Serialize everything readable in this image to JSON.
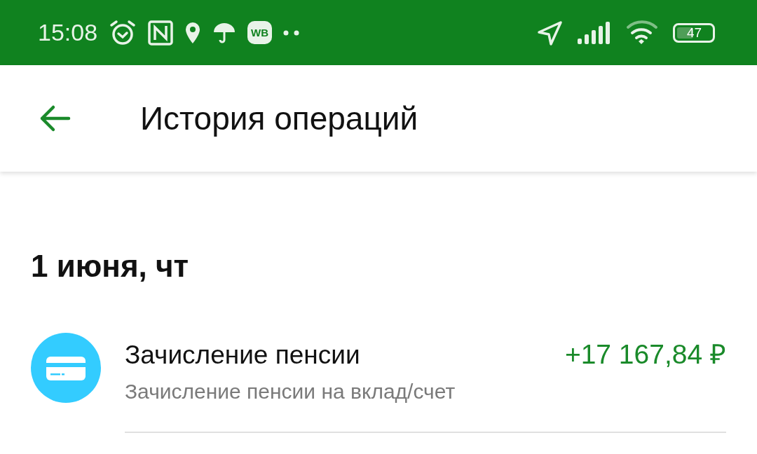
{
  "status_bar": {
    "time": "15:08",
    "app_badge": "WB",
    "battery": {
      "label": "47",
      "level": 0.47
    }
  },
  "header": {
    "title": "История операций"
  },
  "sections": [
    {
      "date": "1 июня, чт",
      "operations": [
        {
          "title": "Зачисление пенсии",
          "subtitle": "Зачисление пенсии на вклад/счет",
          "amount": "+17 167,84 ₽",
          "kind": "income"
        }
      ]
    }
  ]
}
